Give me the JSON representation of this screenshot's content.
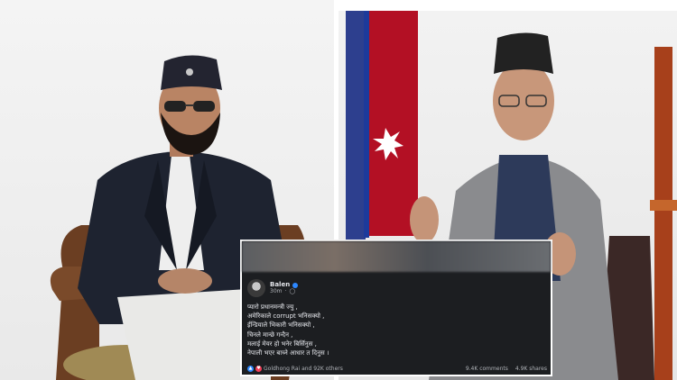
{
  "post": {
    "author": "Balen",
    "time": "30m",
    "privacy_icon": "globe-icon",
    "verified_icon": "verified-badge-icon",
    "lines": [
      "प्यारो प्रधानमन्त्री ज्यु ,",
      "अमेरिकाले corrupt भनिसक्यो ,",
      "ईन्डियाले भिकारी भनिसक्यो ,",
      "चिनले मान्छे गन्दैन ,",
      "मलाई मेयर हो भनेर बिर्सिनुस ,",
      "नेपाली भएर बाच्ने आधार त दिनुस ।"
    ],
    "reactions_text": "Goldhong Rai and 92K others",
    "comments": "9.4K comments",
    "shares": "4.9K shares",
    "colors": {
      "card_bg": "#1c1e21",
      "text": "#e4e6eb",
      "muted": "#b0b3b8",
      "like": "#2d88ff",
      "love": "#f33e58"
    }
  }
}
